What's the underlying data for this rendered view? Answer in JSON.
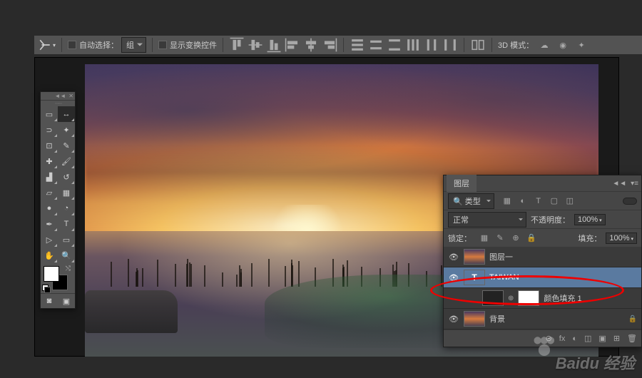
{
  "options_bar": {
    "auto_select_label": "自动选择：",
    "auto_select_target": "组",
    "show_transform_label": "显示变换控件",
    "mode_3d_label": "3D 模式："
  },
  "tools": [
    {
      "name": "marquee",
      "glyph": "▭"
    },
    {
      "name": "move",
      "glyph": "↔"
    },
    {
      "name": "lasso",
      "glyph": "⊃"
    },
    {
      "name": "magic-wand",
      "glyph": "✦"
    },
    {
      "name": "crop",
      "glyph": "⊡"
    },
    {
      "name": "eyedropper",
      "glyph": "✎"
    },
    {
      "name": "healing-brush",
      "glyph": "✚"
    },
    {
      "name": "brush",
      "glyph": "🖌"
    },
    {
      "name": "stamp",
      "glyph": "▟"
    },
    {
      "name": "history-brush",
      "glyph": "↺"
    },
    {
      "name": "eraser",
      "glyph": "▱"
    },
    {
      "name": "gradient",
      "glyph": "▦"
    },
    {
      "name": "blur",
      "glyph": "●"
    },
    {
      "name": "dodge",
      "glyph": "◔"
    },
    {
      "name": "pen",
      "glyph": "✒"
    },
    {
      "name": "type",
      "glyph": "T"
    },
    {
      "name": "path-select",
      "glyph": "▷"
    },
    {
      "name": "shape",
      "glyph": "▭"
    },
    {
      "name": "hand",
      "glyph": "✋"
    },
    {
      "name": "zoom",
      "glyph": "🔍"
    }
  ],
  "foot_tools": [
    {
      "name": "quick-mask",
      "glyph": "◙"
    },
    {
      "name": "screen-mode",
      "glyph": "▣"
    }
  ],
  "layers_panel": {
    "tab_label": "图层",
    "filter_kind": "类型",
    "filter_icons": [
      "▦",
      "◐",
      "T",
      "▢",
      "◫"
    ],
    "blend_mode": "正常",
    "opacity_label": "不透明度：",
    "opacity_value": "100%",
    "lock_label": "锁定：",
    "lock_icons": [
      "▦",
      "✎",
      "⊕",
      "🔒"
    ],
    "fill_label": "填充：",
    "fill_value": "100%",
    "layers": [
      {
        "name": "图层一",
        "type": "image",
        "visible": true,
        "selected": false,
        "locked": false
      },
      {
        "name": "TAIWAN",
        "type": "text",
        "visible": true,
        "selected": true,
        "locked": false
      },
      {
        "name": "颜色填充 1",
        "type": "fill",
        "visible": false,
        "selected": false,
        "locked": false,
        "has_mask": true
      },
      {
        "name": "背景",
        "type": "image",
        "visible": true,
        "selected": false,
        "locked": true
      }
    ],
    "footer_icons": [
      "⊝",
      "fx",
      "◐",
      "◫",
      "▣",
      "⊞",
      "🗑"
    ]
  },
  "watermark": "Baidu 经验"
}
